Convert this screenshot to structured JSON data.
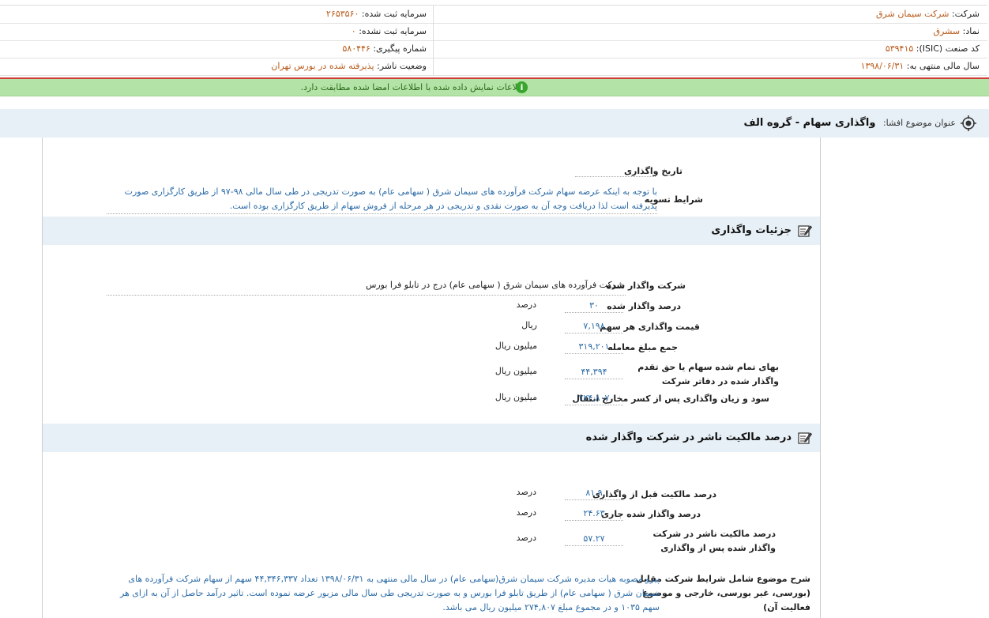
{
  "header": {
    "company_label": "شرکت:",
    "company_value": "شرکت سیمان شرق",
    "symbol_label": "نماد:",
    "symbol_value": "سشرق",
    "isic_label": "کد صنعت (ISIC):",
    "isic_value": "۵۳۹۴۱۵",
    "fiscal_label": "سال مالی منتهی به:",
    "fiscal_value": "۱۳۹۸/۰۶/۳۱",
    "reg_capital_label": "سرمایه ثبت شده:",
    "reg_capital_value": "۲۶۵۳۵۶۰",
    "unreg_capital_label": "سرمایه ثبت نشده:",
    "unreg_capital_value": "۰",
    "tracking_label": "شماره پیگیری:",
    "tracking_value": "۵۸۰۴۴۶",
    "status_label": "وضعیت ناشر:",
    "status_value": "پذیرفته شده در بورس تهران"
  },
  "notice": {
    "message": "اطلاعات نمایش داده شده با اطلاعات امضا شده مطابقت دارد.",
    "icon_glyph": "i"
  },
  "topic": {
    "label": "عنوان موضوع افشا:",
    "title": "واگذاری سهام - گروه الف"
  },
  "top_fields": {
    "date_label": "تاریخ واگذاری",
    "date_value": "",
    "settlement_label": "شرایط تسویه",
    "settlement_value": "با توجه به اینکه عرضه سهام شرکت فرآورده های سیمان شرق ( سهامی عام) به صورت تدریجی در طی سال مالی ۹۸-۹۷ از طریق کارگزاری صورت پذیرفته است لذا دریافت وجه آن به صورت نقدی و تدریجی در هر مرحله از فروش سهام از طریق کارگزاری بوده است."
  },
  "details": {
    "title": "جزئیات واگذاری",
    "company_label": "شرکت واگذار شده",
    "company_value": "شرکت فرآورده های سیمان شرق ( سهامی عام) درج در تابلو فرا بورس",
    "percent_label": "درصد واگذار شده",
    "percent_value": "۳۰",
    "percent_unit": "درصد",
    "price_label": "قیمت واگذاری هر سهم",
    "price_value": "۷,۱۹۸",
    "price_unit": "ریال",
    "total_label": "جمع مبلغ معامله",
    "total_value": "۳۱۹,۲۰۱",
    "total_unit": "میلیون ریال",
    "book_label": "بهای تمام شده سهام یا حق تقدم واگذار شده در دفاتر شرکت",
    "book_value": "۴۴,۳۹۴",
    "book_unit": "میلیون ریال",
    "profit_label": "سود و زیان واگذاری پس از کسر مخارج انتقال",
    "profit_value": "۲۷۴,۸۰۷",
    "profit_unit": "میلیون ریال"
  },
  "ownership": {
    "title": "درصد مالکیت ناشر در شرکت واگذار شده",
    "before_label": "درصد مالکیت قبل از واگذاری",
    "before_value": "۸۱.۹",
    "before_unit": "درصد",
    "current_label": "درصد واگذار شده جاری",
    "current_value": "۲۴.۶۳",
    "current_unit": "درصد",
    "after_label": "درصد مالکیت ناشر در شرکت واگذار شده پس از واگذاری",
    "after_value": "۵۷.۲۷",
    "after_unit": "درصد"
  },
  "description": {
    "label": "شرح موضوع شامل شرایط شرکت مقابل (بورسی، غیر بورسی، خارجی و موضوع فعالیت آن)",
    "value": "پیرو مصوبه هیات مدیره شرکت سیمان شرق(سهامی عام) در سال مالی منتهی به ۱۳۹۸/۰۶/۳۱ تعداد ۴۴,۳۴۶,۳۳۷ سهم از سهام شرکت فرآورده های سیمان شرق ( سهامی عام) از طریق تابلو فرا بورس و به صورت تدریجی طی سال مالی مزبور عرضه نموده است. تاثیر درآمد حاصل از آن به ازای هر سهم ۱۰۳۵ و در مجموع مبلغ ۲۷۴,۸۰۷ میلیون ریال می باشد."
  }
}
